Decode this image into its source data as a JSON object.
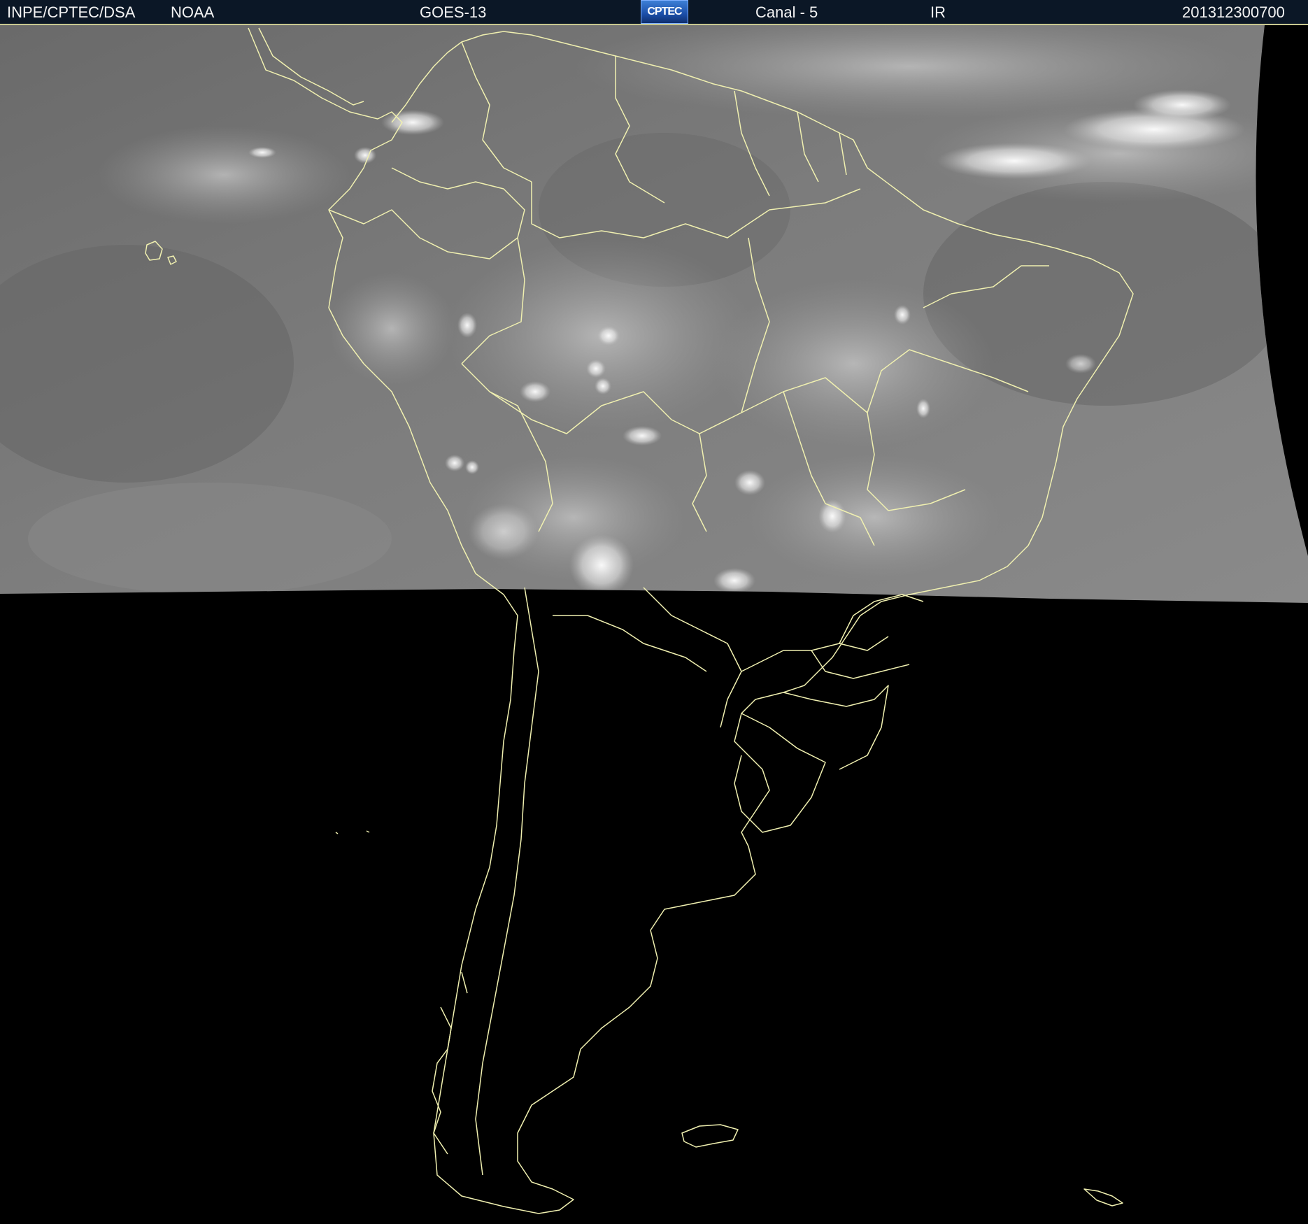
{
  "header": {
    "agency": "INPE/CPTEC/DSA",
    "source": "NOAA",
    "satellite": "GOES-13",
    "logo_text": "CPTEC",
    "channel": "Canal - 5",
    "band": "IR",
    "timestamp": "201312300700"
  },
  "colors": {
    "header_background": "#0b1726",
    "header_text": "#f4f4f4",
    "coastline": "#f0f0b0",
    "no_data": "#000000",
    "cloud_field": "#7a7a7a"
  },
  "map": {
    "type": "satellite-infrared-image",
    "region": "South America",
    "coverage": "northern half imaged; southern half black (no data)"
  }
}
